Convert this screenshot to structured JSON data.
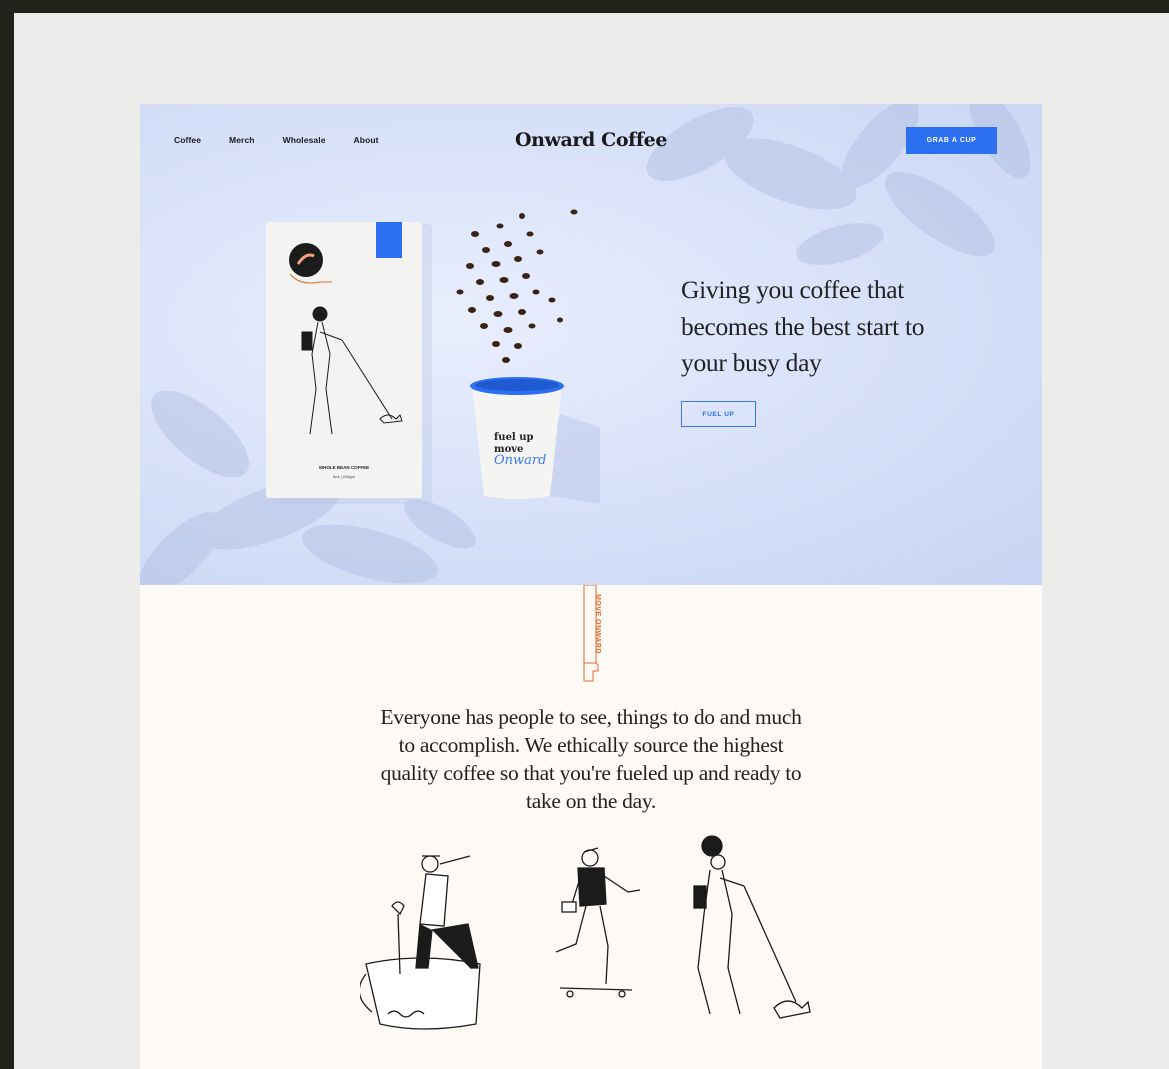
{
  "nav": {
    "items": [
      "Coffee",
      "Merch",
      "Wholesale",
      "About"
    ]
  },
  "brand": "Onward Coffee",
  "header": {
    "cta_label": "GRAB A CUP"
  },
  "hero": {
    "headline": "Giving you coffee that becomes the best start to your busy day",
    "button_label": "FUEL UP",
    "bag_label": "WHOLE BEAN COFFEE",
    "bag_weight": "8oz | 226gm",
    "cup_text_line1": "fuel up",
    "cup_text_line2": "move",
    "cup_text_script": "Onward"
  },
  "divider_tag": "MOVE ONWARD",
  "intro": {
    "text": "Everyone has people to see, things to do and much to accomplish. We ethically source the highest quality coffee so that you're fueled up and ready to take on the day."
  },
  "colors": {
    "accent": "#2c6ff0",
    "orange": "#e3692a",
    "hero_bg": "#dbe4fa",
    "cream": "#fdfaf5",
    "outer": "#23221a"
  },
  "icons": [
    "hand-pointer-icon",
    "coffee-bean-icon"
  ]
}
